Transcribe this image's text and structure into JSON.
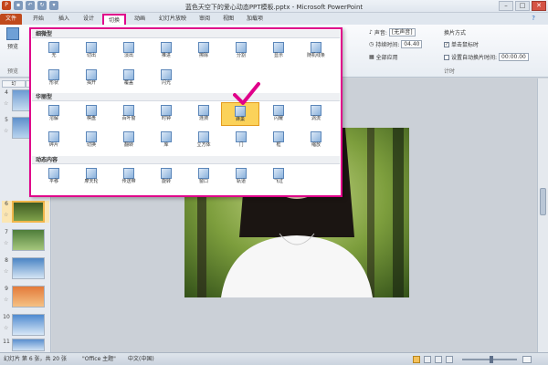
{
  "window": {
    "title": "蓝色天空下的爱心动态PPT模板.pptx - Microsoft PowerPoint",
    "minimize": "–",
    "maximize": "□",
    "close": "✕"
  },
  "tabs": [
    "文件",
    "开始",
    "插入",
    "设计",
    "切换",
    "动画",
    "幻灯片放映",
    "审阅",
    "视图",
    "加载项"
  ],
  "ribbon": {
    "preview_label": "预览",
    "preview_group": "预览",
    "sound_label": "声音:",
    "sound_value": "[无声音]",
    "duration_label": "持续时间:",
    "duration_value": "04.40",
    "apply_all": "全部应用",
    "advance_title": "换片方式",
    "on_click": "单击鼠标时",
    "after_label": "设置自动换片时间:",
    "after_value": "00:00.00",
    "group_timing": "计时"
  },
  "gallery": {
    "sections": [
      "细微型",
      "华丽型",
      "动态内容"
    ],
    "subtle": [
      "无",
      "切出",
      "淡出",
      "推进",
      "擦除",
      "分割",
      "显示",
      "随机线条",
      "形状",
      "揭开",
      "覆盖",
      "闪光"
    ],
    "exciting": [
      "溶解",
      "棋盘",
      "百叶窗",
      "时钟",
      "涟漪",
      "蜂巢",
      "闪耀",
      "涡流",
      "碎片",
      "切换",
      "翻转",
      "库",
      "立方体",
      "门",
      "框",
      "缩放"
    ],
    "dynamic": [
      "平移",
      "摩天轮",
      "传送带",
      "旋转",
      "窗口",
      "轨道",
      "飞过"
    ],
    "selected": "蜂巢"
  },
  "pane": {
    "tabs": [
      "幻",
      "大"
    ],
    "slides": [
      "4",
      "5",
      "6",
      "7",
      "8",
      "9",
      "10",
      "11"
    ],
    "active": "6"
  },
  "status": {
    "slide_info": "幻灯片 第 6 张，共 20 张",
    "theme": "\"Office 主题\"",
    "language": "中文(中国)"
  },
  "colors": {
    "accent": "#e0008a",
    "file_tab": "#c04a1c",
    "selected_item": "#fbd25a"
  }
}
